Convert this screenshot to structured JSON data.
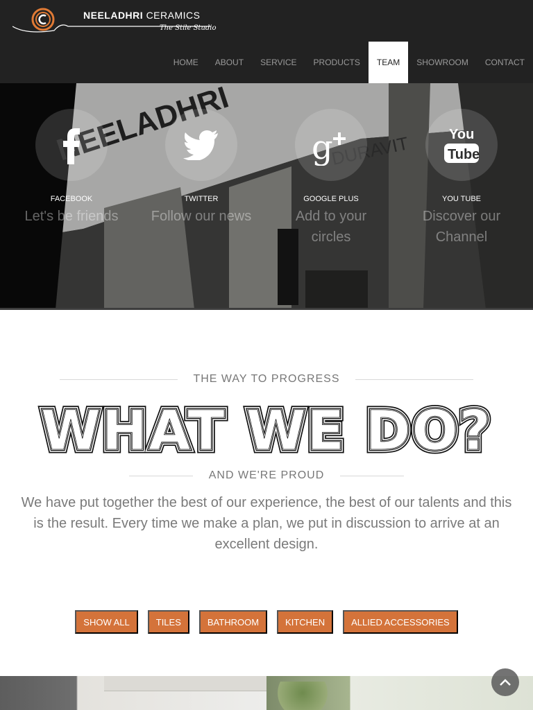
{
  "header": {
    "brand_bold": "NEELADHRI",
    "brand_light": "CERAMICS",
    "tagline": "The Stile Studio"
  },
  "nav": {
    "items": [
      {
        "label": "HOME",
        "active": false
      },
      {
        "label": "ABOUT",
        "active": false
      },
      {
        "label": "SERVICE",
        "active": false
      },
      {
        "label": "PRODUCTS",
        "active": false
      },
      {
        "label": "TEAM",
        "active": true
      },
      {
        "label": "SHOWROOM",
        "active": false
      },
      {
        "label": "CONTACT",
        "active": false
      }
    ]
  },
  "hero": {
    "social": [
      {
        "icon": "facebook-icon",
        "label": "FACEBOOK",
        "sub": "Let's be friends"
      },
      {
        "icon": "twitter-icon",
        "label": "TWITTER",
        "sub": "Follow our news"
      },
      {
        "icon": "google-plus-icon",
        "label": "GOOGLE PLUS",
        "sub": "Add to your circles"
      },
      {
        "icon": "youtube-icon",
        "label": "YOU TUBE",
        "sub": "Discover our Channel"
      }
    ],
    "background_lettering": [
      "NEELADHRI",
      "DURAVIT"
    ]
  },
  "section": {
    "kicker_top": "THE WAY TO PROGRESS",
    "headline": "WHAT WE DO?",
    "kicker_bottom": "AND WE'RE PROUD",
    "body": "We have put together the best of our experience, the best of our talents and this is the result. Every time we make a plan, we put in discussion to arrive at an excellent design."
  },
  "filters": {
    "buttons": [
      "SHOW ALL",
      "TILES",
      "BATHROOM",
      "KITCHEN",
      "ALLIED ACCESSORIES"
    ]
  },
  "colors": {
    "header_bg": "#222222",
    "accent": "#d4733a",
    "nav_text": "#9a9a9a",
    "body_text": "#7a7a7a"
  },
  "icons": {
    "scroll_top": "chevron-up-icon"
  }
}
